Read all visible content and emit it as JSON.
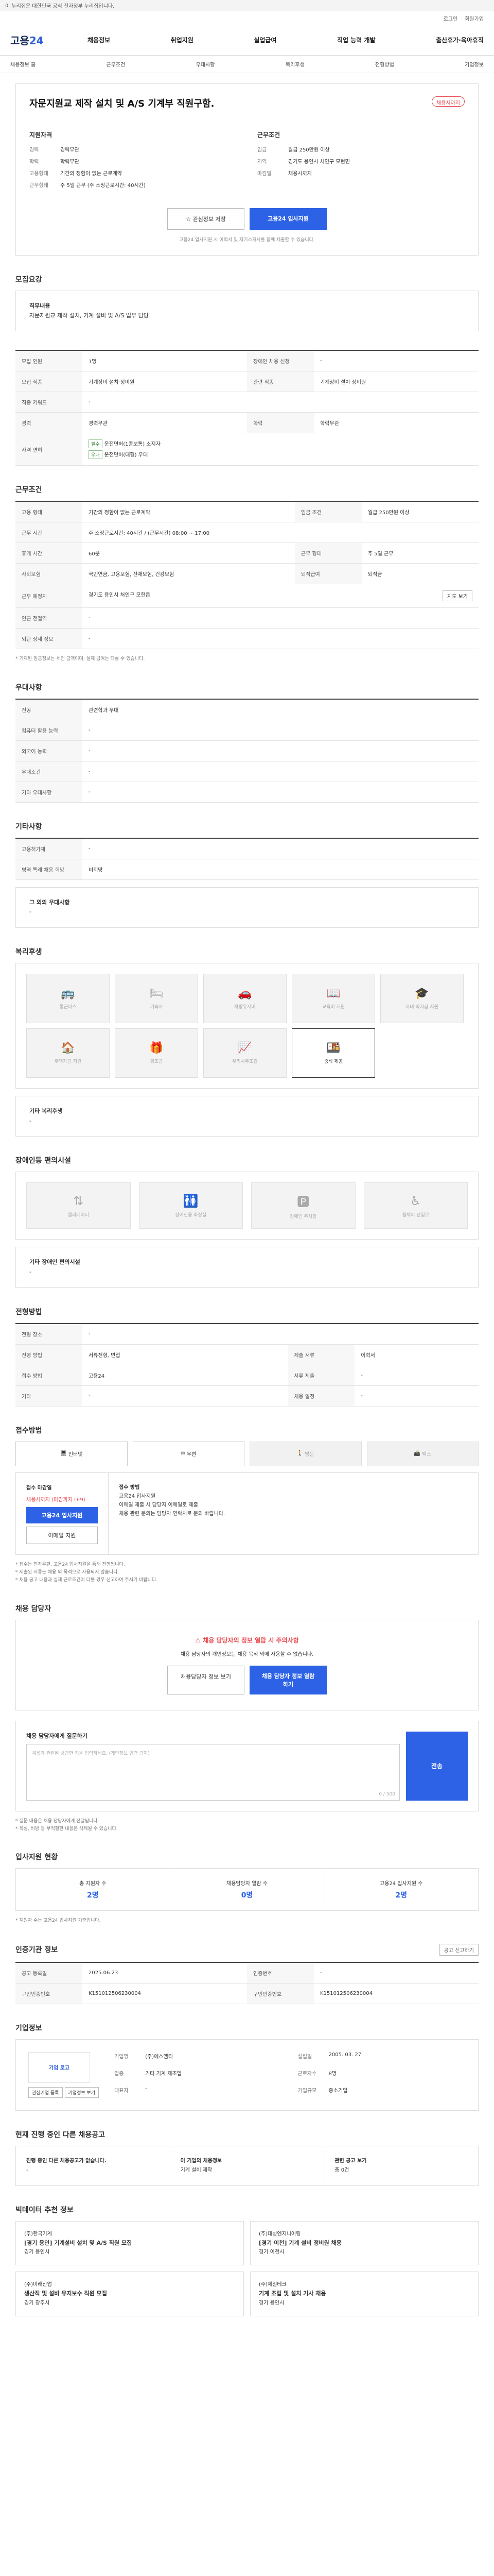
{
  "topbar": {
    "notice": "이 누리집은 대한민국 공식 전자정부 누리집입니다."
  },
  "util": {
    "login": "로그인",
    "join": "회원가입"
  },
  "gnb": {
    "logo_a": "고용",
    "logo_b": "24",
    "menu": [
      "채용정보",
      "취업지원",
      "실업급여",
      "직업 능력 개발",
      "출산휴가·육아휴직"
    ]
  },
  "lnb": [
    "채용정보 홈",
    "근무조건",
    "우대사항",
    "복리후생",
    "전형방법",
    "기업정보"
  ],
  "job": {
    "title": "자문지원교 제작 설치 및 A/S 기계부 직원구함.",
    "status_badge": "채용시까지",
    "left_title": "지원자격",
    "left": [
      {
        "k": "경력",
        "v": "경력무관"
      },
      {
        "k": "학력",
        "v": "학력무관"
      },
      {
        "k": "고용형태",
        "v": "기간의 정함이 없는 근로계약"
      },
      {
        "k": "근무형태",
        "v": "주 5일 근무 (주 소정근로시간: 40시간)"
      }
    ],
    "right_title": "근무조건",
    "right": [
      {
        "k": "임금",
        "v": "월급 250만원 이상"
      },
      {
        "k": "지역",
        "v": "경기도 용인시 처인구 모현면"
      },
      {
        "k": "마감일",
        "v": "채용시까지"
      }
    ],
    "btn_scrap": "관심정보 저장",
    "btn_apply": "고용24 입사지원",
    "apply_note": "고용24 입사지원 시 이력서 및 자기소개서를 함께 제출할 수 있습니다."
  },
  "duty": {
    "heading": "모집요강",
    "title": "직무내용",
    "body": "자문지원교 제작 설치, 기계 설비 및 A/S 업무 담당"
  },
  "recruit_table": {
    "rows": [
      {
        "k": "모집 인원",
        "v": "1명",
        "k2": "장애인 채용 신청",
        "v2": "-"
      },
      {
        "k": "모집 직종",
        "v": "기계장비 설치·정비원",
        "k2": "관련 직종",
        "v2": "기계장비 설치·정비원"
      },
      {
        "k": "직종 키워드",
        "v": "-",
        "k2": "",
        "v2": ""
      },
      {
        "k": "경력",
        "v": "경력무관",
        "k2": "학력",
        "v2": "학력무관"
      },
      {
        "k": "자격 면허",
        "v": "-",
        "k2": "",
        "v2": ""
      }
    ],
    "tag1": "필수",
    "tag2": "우대",
    "tag1_text": "운전면허(1종보통) 소지자",
    "tag2_text": "운전면허(대형) 우대"
  },
  "cond": {
    "heading": "근무조건",
    "rows": [
      {
        "k": "고용 형태",
        "v": "기간의 정함이 없는 근로계약",
        "k2": "임금 조건",
        "v2": "월급 250만원 이상"
      },
      {
        "k": "근무 시간",
        "v": "주 소정근로시간: 40시간 / (근무시간) 08:00 ~ 17:00",
        "k2": "",
        "v2": ""
      },
      {
        "k": "휴게 시간",
        "v": "60분",
        "k2": "근무 형태",
        "v2": "주 5일 근무"
      },
      {
        "k": "사회보험",
        "v": "국민연금, 고용보험, 산재보험, 건강보험",
        "k2": "퇴직급여",
        "v2": "퇴직금"
      },
      {
        "k": "근무 예정지",
        "v": "경기도 용인시 처인구 모현읍",
        "k2": "",
        "v2": ""
      },
      {
        "k": "인근 전철역",
        "v": "-",
        "k2": "",
        "v2": ""
      },
      {
        "k": "퇴근 상세 정보",
        "v": "-",
        "k2": "",
        "v2": ""
      }
    ],
    "map_btn": "지도 보기",
    "note": "* 기재된 임금정보는 세전 금액이며, 실제 급여는 다를 수 있습니다."
  },
  "pref": {
    "heading": "우대사항",
    "rows": [
      {
        "k": "전공",
        "v": "관련학과 우대"
      },
      {
        "k": "컴퓨터 활용 능력",
        "v": "-"
      },
      {
        "k": "외국어 능력",
        "v": "-"
      },
      {
        "k": "우대조건",
        "v": "-"
      },
      {
        "k": "기타 우대사항",
        "v": "-"
      }
    ]
  },
  "etc": {
    "heading": "기타사항",
    "rows": [
      {
        "k": "고용허가제",
        "v": "-"
      },
      {
        "k": "병역 특례 채용 희망",
        "v": "비희망"
      }
    ],
    "sub_title": "그 외의 우대사항",
    "sub_value": "-"
  },
  "welfare": {
    "heading": "복리후생",
    "items": [
      "통근버스",
      "기숙사",
      "차량유지비",
      "교육비 지원",
      "자녀 학자금 지원",
      "주택자금 지원",
      "경조금",
      "우리사주조합",
      "중식 제공"
    ],
    "extra_title": "기타 복리후생",
    "extra_value": "-"
  },
  "disab": {
    "heading": "장애인등 편의시설",
    "items": [
      "엘리베이터",
      "장애인용 화장실",
      "장애인 주차장",
      "휠체어 진입로"
    ],
    "extra_title": "기타 장애인 편의시설",
    "extra_value": "-"
  },
  "screening": {
    "heading": "전형방법",
    "rows": [
      {
        "k": "전형 장소",
        "v": "-",
        "k2": "",
        "v2": ""
      },
      {
        "k": "전형 방법",
        "v": "서류전형, 면접",
        "k2": "제출 서류",
        "v2": "이력서"
      },
      {
        "k": "접수 방법",
        "v": "고용24",
        "k2": "서류 제출",
        "v2": "-"
      },
      {
        "k": "기타",
        "v": "-",
        "k2": "채용 일정",
        "v2": "-"
      }
    ]
  },
  "apply": {
    "heading": "접수방법",
    "methods": [
      "인터넷",
      "우편",
      "방문",
      "팩스"
    ],
    "left_title": "접수 마감일",
    "left_value": "채용시까지 (마감까지 D-9)",
    "left_btn1": "고용24 입사지원",
    "left_btn2": "이메일 지원",
    "right_title": "접수 방법",
    "right_lines": [
      "고용24 입사지원",
      "이메일 제출 시 담당자 이메일로 제출",
      "채용 관련 문의는 담당자 연락처로 문의 바랍니다."
    ],
    "notes": [
      "* 접수는 전자우편, 고용24 입사지원을 통해 진행됩니다.",
      "* 제출된 서류는 채용 외 목적으로 사용되지 않습니다.",
      "* 채용 공고 내용과 실제 근로조건이 다를 경우 신고하여 주시기 바랍니다."
    ]
  },
  "contact": {
    "heading": "채용 담당자",
    "warn_title": "채용 담당자의 정보 열람 시 주의사항",
    "warn_text": "채용 담당자의 개인정보는 채용 목적 외에 사용할 수 없습니다.",
    "btn1": "채용담당자 정보 보기",
    "btn2": "채용 담당자 정보 열람하기"
  },
  "qna": {
    "heading": "채용 담당자에게 질문하기",
    "placeholder": "채용과 관련된 궁금한 점을 입력하세요. (개인정보 입력 금지)",
    "counter": "0 / 500",
    "btn": "전송",
    "notes": [
      "* 질문 내용은 채용 담당자에게 전달됩니다.",
      "* 욕설, 비방 등 부적절한 내용은 삭제될 수 있습니다."
    ]
  },
  "stats": {
    "heading": "입사지원 현황",
    "items": [
      {
        "label": "총 지원자 수",
        "value": "2명"
      },
      {
        "label": "채용담당자 열람 수",
        "value": "0명"
      },
      {
        "label": "고용24 입사지원 수",
        "value": "2명"
      }
    ],
    "note": "* 지원자 수는 고용24 입사지원 기준입니다."
  },
  "meta": {
    "heading": "인증기관 정보",
    "rows": [
      {
        "k": "공고 등록일",
        "v": "2025.06.23",
        "k2": "인증번호",
        "v2": "-"
      },
      {
        "k": "구인인증번호",
        "v": "K151012506230004",
        "k2": "구인인증번호",
        "v2": "K151012506230004"
      }
    ],
    "btn": "공고 신고하기"
  },
  "company": {
    "heading": "기업정보",
    "logo": "기업 로고",
    "btn1": "관심기업 등록",
    "btn2": "기업정보 보기",
    "info": [
      {
        "k": "기업명",
        "v": "(주)에스엠티"
      },
      {
        "k": "설립일",
        "v": "2005. 03. 27"
      },
      {
        "k": "업종",
        "v": "기타 기계 제조업"
      },
      {
        "k": "근로자수",
        "v": "8명"
      },
      {
        "k": "대표자",
        "v": "-"
      },
      {
        "k": "기업규모",
        "v": "중소기업"
      }
    ]
  },
  "others": {
    "heading": "현재 진행 중인 다른 채용공고",
    "items": [
      {
        "title": "진행 중인 다른 채용공고가 없습니다.",
        "sub": "-"
      },
      {
        "title": "이 기업의 채용정보",
        "sub": "기계 설비 제작"
      },
      {
        "title": "관련 공고 보기",
        "sub": "총 0건"
      }
    ]
  },
  "recommend": {
    "heading": "빅데이터 추천 정보",
    "items": [
      {
        "company": "(주)한국기계",
        "title": "[경기 용인] 기계설비 설치 및 A/S 직원 모집",
        "sub": "경기 용인시"
      },
      {
        "company": "(주)대성엔지니어링",
        "title": "[경기 이천] 기계 설비 정비원 채용",
        "sub": "경기 이천시"
      },
      {
        "company": "(주)미래산업",
        "title": "생산직 및 설비 유지보수 직원 모집",
        "sub": "경기 광주시"
      },
      {
        "company": "(주)제일테크",
        "title": "기계 조립 및 설치 기사 채용",
        "sub": "경기 용인시"
      }
    ]
  }
}
